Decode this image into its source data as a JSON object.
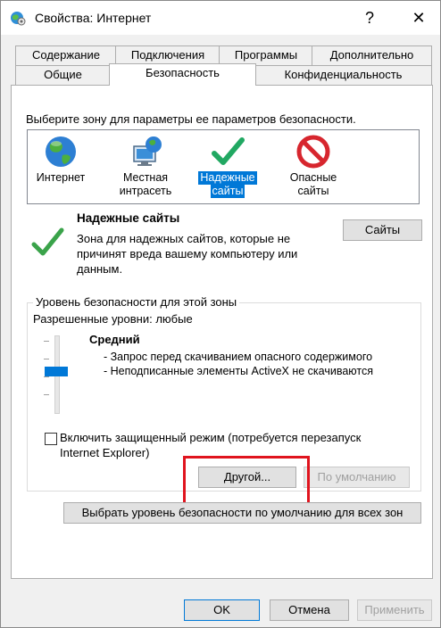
{
  "window": {
    "title": "Свойства: Интернет",
    "help_glyph": "?",
    "close_glyph": "✕"
  },
  "tabs": {
    "row1": [
      {
        "label": "Содержание"
      },
      {
        "label": "Подключения"
      },
      {
        "label": "Программы"
      },
      {
        "label": "Дополнительно"
      }
    ],
    "row2": [
      {
        "label": "Общие"
      },
      {
        "label": "Безопасность"
      },
      {
        "label": "Конфиденциальность"
      }
    ],
    "active": "Безопасность"
  },
  "security": {
    "zone_prompt": "Выберите зону для параметры ее параметров безопасности.",
    "zones": [
      {
        "line1": "Интернет",
        "line2": "",
        "icon": "globe-icon"
      },
      {
        "line1": "Местная",
        "line2": "интрасеть",
        "icon": "intranet-icon"
      },
      {
        "line1": "Надежные",
        "line2": "сайты",
        "icon": "checkmark-icon"
      },
      {
        "line1": "Опасные",
        "line2": "сайты",
        "icon": "restricted-icon"
      }
    ],
    "selected_zone": "Надежные сайты",
    "zone_title": "Надежные сайты",
    "zone_description": "Зона для надежных сайтов, которые не принят вреда вашему компьютеру или данным.",
    "zone_description_lines": [
      "Зона для надежных сайтов, которые не",
      "причинят вреда вашему компьютеру или",
      "данным."
    ],
    "sites_button": "Сайты",
    "level_group_title": "Уровень безопасности для этой зоны",
    "allowed_levels": "Разрешенные уровни: любые",
    "level_name": "Средний",
    "level_bullets": [
      "- Запрос перед скачиванием опасного содержимого",
      "- Неподписанные элементы ActiveX не скачиваются"
    ],
    "protected_mode_label_line1": "Включить защищенный режим (потребуется перезапуск",
    "protected_mode_label_line2": "Internet Explorer)",
    "protected_mode_checked": false,
    "custom_button": "Другой...",
    "default_button": "По умолчанию",
    "reset_all_button": "Выбрать уровень безопасности по умолчанию для всех зон",
    "slider_level": "2 of 4"
  },
  "footer": {
    "ok": "OK",
    "cancel": "Отмена",
    "apply": "Применить"
  },
  "colors": {
    "selection": "#0078d7",
    "highlight_box": "#e0141e",
    "check_green": "#3aa34a"
  }
}
